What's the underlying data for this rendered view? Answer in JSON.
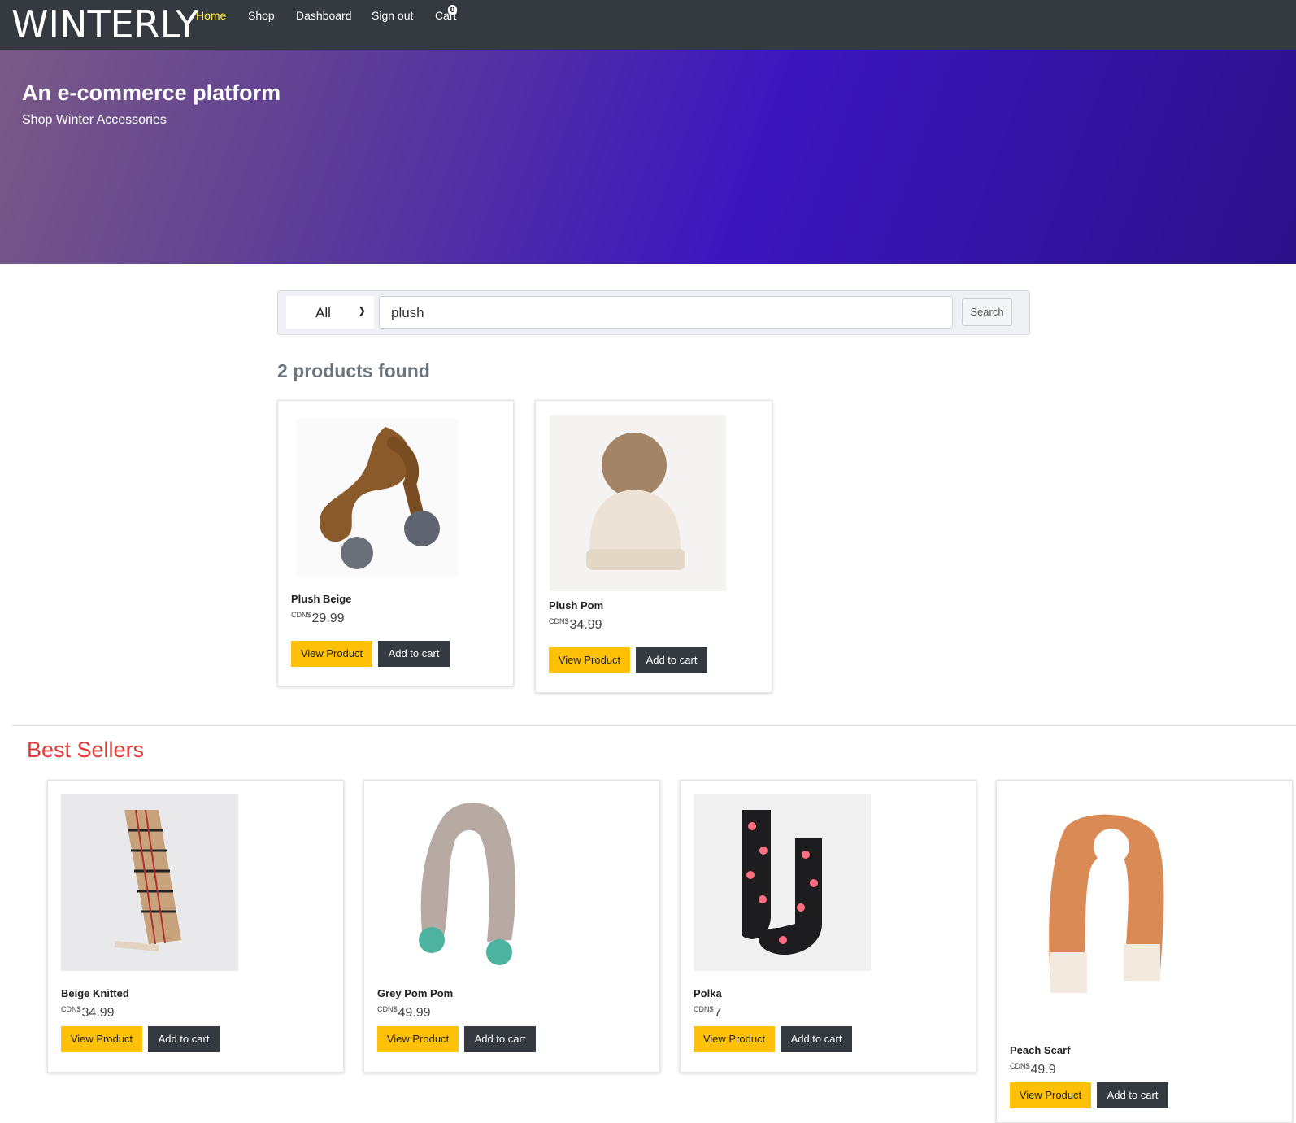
{
  "nav": {
    "brand": "WINTERLY",
    "links": [
      "Home",
      "Shop",
      "Dashboard",
      "Sign out",
      "Cart"
    ],
    "cart_count": "0"
  },
  "hero": {
    "title": "An e-commerce platform",
    "subtitle": "Shop Winter Accessories"
  },
  "search": {
    "category": "All",
    "query": "plush",
    "button": "Search"
  },
  "results": {
    "count_label": "2 products found",
    "items": [
      {
        "name": "Plush Beige",
        "currency": "CDN$",
        "price": "29.99",
        "view": "View Product",
        "add": "Add to cart"
      },
      {
        "name": "Plush Pom",
        "currency": "CDN$",
        "price": "34.99",
        "view": "View Product",
        "add": "Add to cart"
      }
    ]
  },
  "best_sellers": {
    "title": "Best Sellers",
    "items": [
      {
        "name": "Beige Knitted",
        "currency": "CDN$",
        "price": "34.99",
        "view": "View Product",
        "add": "Add to cart"
      },
      {
        "name": "Grey Pom Pom",
        "currency": "CDN$",
        "price": "49.99",
        "view": "View Product",
        "add": "Add to cart"
      },
      {
        "name": "Polka",
        "currency": "CDN$",
        "price": "7",
        "view": "View Product",
        "add": "Add to cart"
      },
      {
        "name": "Peach Scarf",
        "currency": "CDN$",
        "price": "49.9",
        "view": "View Product",
        "add": "Add to cart"
      }
    ]
  },
  "colors": {
    "navbar": "#343a40",
    "active_link": "#ffeb3b",
    "view_button": "#ffc107",
    "add_button": "#343a40",
    "best_sellers_title": "#e53935"
  }
}
